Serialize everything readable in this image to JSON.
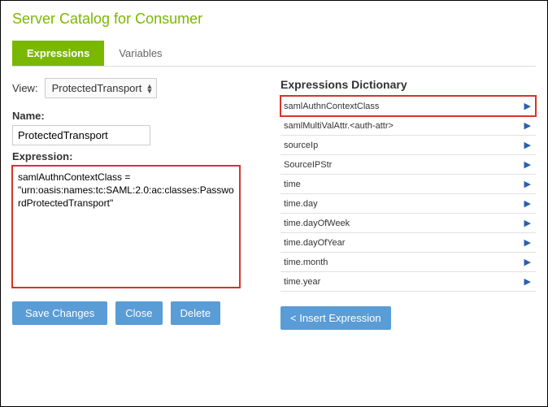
{
  "page": {
    "title": "Server Catalog for Consumer"
  },
  "tabs": [
    {
      "label": "Expressions",
      "active": true
    },
    {
      "label": "Variables",
      "active": false
    }
  ],
  "view": {
    "label": "View:",
    "selected": "ProtectedTransport"
  },
  "form": {
    "name_label": "Name:",
    "name_value": "ProtectedTransport",
    "expression_label": "Expression:",
    "expression_value": "samlAuthnContextClass = \"urn:oasis:names:tc:SAML:2.0:ac:classes:PasswordProtectedTransport\""
  },
  "buttons": {
    "save": "Save Changes",
    "close": "Close",
    "delete": "Delete",
    "insert": "<  Insert Expression"
  },
  "dictionary": {
    "title": "Expressions Dictionary",
    "items": [
      "samlAuthnContextClass",
      "samlMultiValAttr.<auth-attr>",
      "sourceIp",
      "SourceIPStr",
      "time",
      "time.day",
      "time.dayOfWeek",
      "time.dayOfYear",
      "time.month",
      "time.year"
    ]
  }
}
